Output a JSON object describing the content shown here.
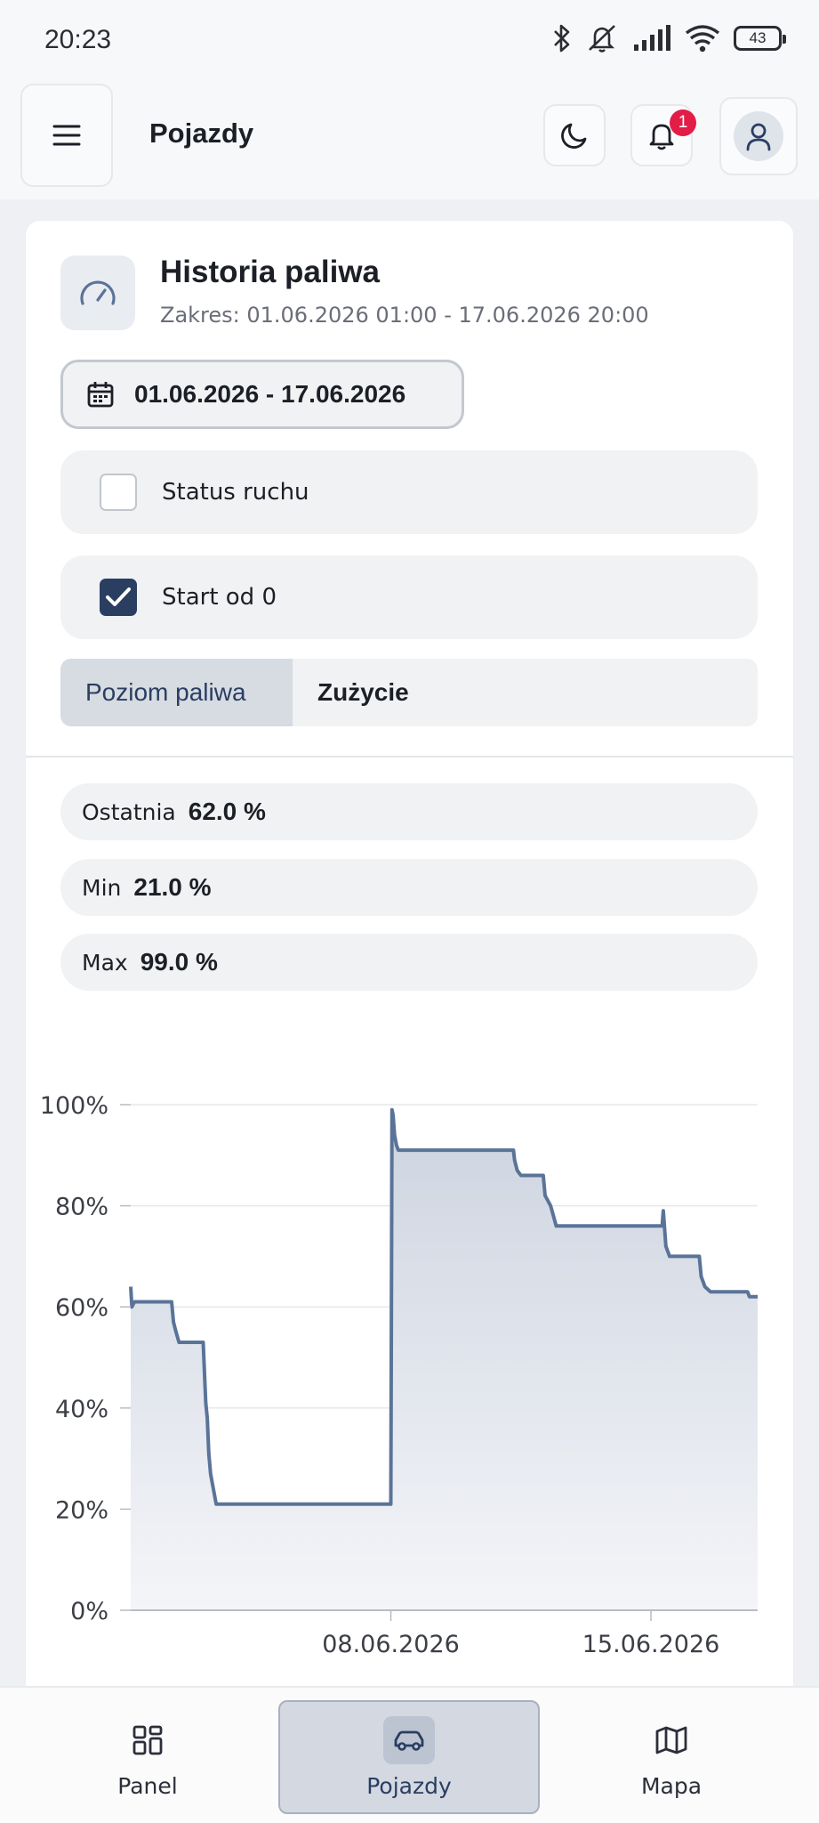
{
  "status_bar": {
    "time": "20:23",
    "battery": "43"
  },
  "header": {
    "title": "Pojazdy",
    "notification_count": "1"
  },
  "card": {
    "title": "Historia paliwa",
    "subtitle": "Zakres: 01.06.2026 01:00 - 17.06.2026 20:00",
    "date_range": "01.06.2026 - 17.06.2026",
    "checkboxes": [
      {
        "label": "Status ruchu",
        "checked": false
      },
      {
        "label": "Start od 0",
        "checked": true
      }
    ],
    "tabs": [
      {
        "label": "Poziom paliwa",
        "active": true
      },
      {
        "label": "Zużycie",
        "active": false
      }
    ],
    "stats": [
      {
        "label": "Ostatnia",
        "value": "62.0 %"
      },
      {
        "label": "Min",
        "value": "21.0 %"
      },
      {
        "label": "Max",
        "value": "99.0 %"
      }
    ]
  },
  "chart_data": {
    "type": "area",
    "title": "",
    "xlabel": "",
    "ylabel": "",
    "ylim": [
      0,
      100
    ],
    "yticks": [
      "0%",
      "20%",
      "40%",
      "60%",
      "80%",
      "100%"
    ],
    "xticks": [
      {
        "label": "08.06.2026",
        "value": 7.0
      },
      {
        "label": "15.06.2026",
        "value": 14.0
      }
    ],
    "x_unit": "days since 01.06.2026 00:00",
    "series": [
      {
        "values": [
          [
            0.0,
            64
          ],
          [
            0.03,
            60
          ],
          [
            0.1,
            61
          ],
          [
            1.1,
            61
          ],
          [
            1.15,
            57
          ],
          [
            1.22,
            55
          ],
          [
            1.3,
            53
          ],
          [
            1.95,
            53
          ],
          [
            1.98,
            48
          ],
          [
            2.02,
            41
          ],
          [
            2.06,
            38
          ],
          [
            2.1,
            31
          ],
          [
            2.15,
            27
          ],
          [
            2.2,
            25
          ],
          [
            2.3,
            21
          ],
          [
            7.0,
            21
          ],
          [
            7.03,
            99
          ],
          [
            7.06,
            98
          ],
          [
            7.1,
            94
          ],
          [
            7.15,
            92
          ],
          [
            7.2,
            91
          ],
          [
            10.3,
            91
          ],
          [
            10.33,
            89
          ],
          [
            10.4,
            87
          ],
          [
            10.5,
            86
          ],
          [
            11.1,
            86
          ],
          [
            11.15,
            82
          ],
          [
            11.3,
            80
          ],
          [
            11.45,
            76
          ],
          [
            14.3,
            76
          ],
          [
            14.33,
            79
          ],
          [
            14.4,
            72
          ],
          [
            14.5,
            70
          ],
          [
            15.3,
            70
          ],
          [
            15.35,
            66
          ],
          [
            15.45,
            64
          ],
          [
            15.6,
            63
          ],
          [
            16.6,
            63
          ],
          [
            16.65,
            62
          ],
          [
            16.87,
            62
          ]
        ]
      }
    ],
    "line_color": "#5a7398",
    "fill_color": "#d7dce6",
    "grid": true
  },
  "bottom_nav": {
    "items": [
      {
        "label": "Panel",
        "icon": "grid-icon",
        "active": false
      },
      {
        "label": "Pojazdy",
        "icon": "car-icon",
        "active": true
      },
      {
        "label": "Mapa",
        "icon": "map-icon",
        "active": false
      }
    ]
  }
}
